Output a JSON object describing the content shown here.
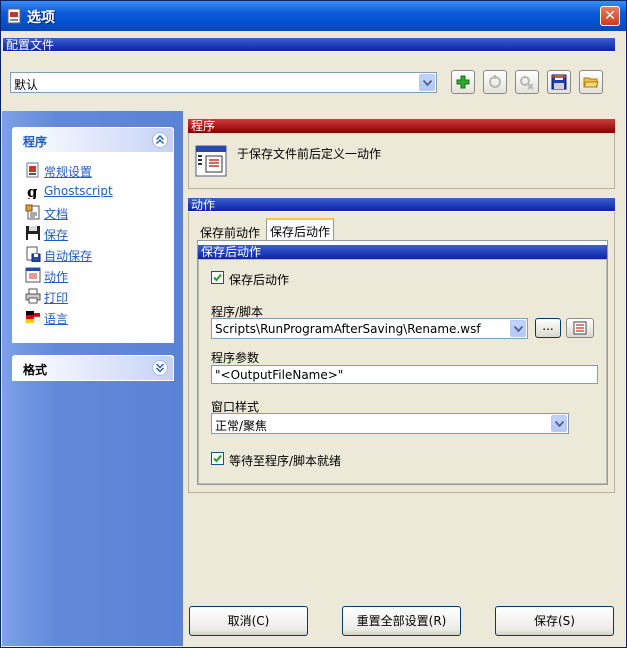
{
  "window": {
    "title": "选项",
    "close_label": "✕"
  },
  "profile": {
    "section_label": "配置文件",
    "selected": "默认",
    "toolbar_icons": [
      "add-profile-icon",
      "rename-profile-icon",
      "delete-profile-icon",
      "save-profile-icon",
      "open-profile-icon"
    ]
  },
  "sidebar": {
    "group1": {
      "title": "程序",
      "items": [
        {
          "label": "常规设置",
          "icon": "general-settings-icon"
        },
        {
          "label": "Ghostscript",
          "icon": "ghostscript-icon"
        },
        {
          "label": "文档",
          "icon": "document-icon"
        },
        {
          "label": "保存",
          "icon": "save-icon"
        },
        {
          "label": "自动保存",
          "icon": "autosave-icon"
        },
        {
          "label": "动作",
          "icon": "actions-icon"
        },
        {
          "label": "打印",
          "icon": "print-icon"
        },
        {
          "label": "语言",
          "icon": "language-flag-icon"
        }
      ]
    },
    "group2": {
      "title": "格式"
    }
  },
  "main": {
    "header": {
      "title": "程序",
      "description": "于保存文件前后定义一动作"
    },
    "actions": {
      "title": "动作",
      "tabs": [
        "保存前动作",
        "保存后动作"
      ],
      "active_tab": 1,
      "subpanel_title": "保存后动作",
      "enable_checkbox": {
        "label": "保存后动作",
        "checked": true
      },
      "program_label": "程序/脚本",
      "program_value": "Scripts\\RunProgramAfterSaving\\Rename.wsf",
      "browse_label": "...",
      "params_label": "程序参数",
      "params_value": "\"<OutputFileName>\"",
      "window_style_label": "窗口样式",
      "window_style_value": "正常/聚焦",
      "wait_checkbox": {
        "label": "等待至程序/脚本就绪",
        "checked": true
      }
    }
  },
  "buttons": {
    "cancel": "取消(C)",
    "reset": "重置全部设置(R)",
    "save": "保存(S)"
  }
}
